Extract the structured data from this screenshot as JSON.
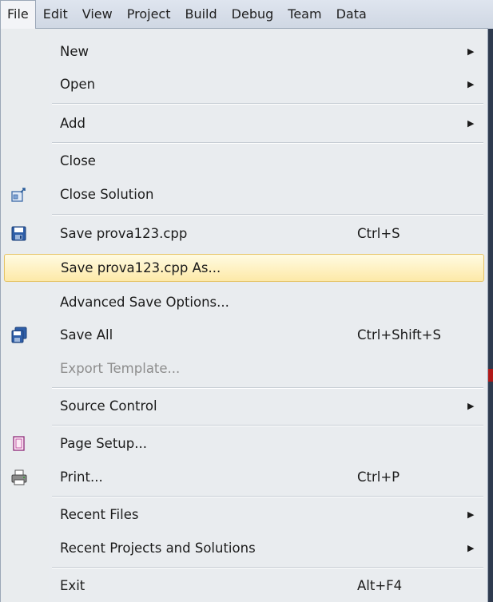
{
  "menubar": {
    "items": [
      {
        "label": "File",
        "active": true
      },
      {
        "label": "Edit"
      },
      {
        "label": "View"
      },
      {
        "label": "Project"
      },
      {
        "label": "Build"
      },
      {
        "label": "Debug"
      },
      {
        "label": "Team"
      },
      {
        "label": "Data"
      }
    ]
  },
  "file_menu": {
    "items": [
      {
        "label": "New",
        "submenu": true
      },
      {
        "label": "Open",
        "submenu": true
      },
      {
        "label": "Add",
        "submenu": true
      },
      {
        "label": "Close"
      },
      {
        "label": "Close Solution",
        "icon": "close-solution-icon"
      },
      {
        "label": "Save prova123.cpp",
        "shortcut": "Ctrl+S",
        "icon": "save-icon"
      },
      {
        "label": "Save prova123.cpp As...",
        "highlighted": true
      },
      {
        "label": "Advanced Save Options..."
      },
      {
        "label": "Save All",
        "shortcut": "Ctrl+Shift+S",
        "icon": "save-all-icon"
      },
      {
        "label": "Export Template...",
        "disabled": true
      },
      {
        "label": "Source Control",
        "submenu": true
      },
      {
        "label": "Page Setup...",
        "icon": "page-setup-icon"
      },
      {
        "label": "Print...",
        "shortcut": "Ctrl+P",
        "icon": "printer-icon"
      },
      {
        "label": "Recent Files",
        "submenu": true
      },
      {
        "label": "Recent Projects and Solutions",
        "submenu": true
      },
      {
        "label": "Exit",
        "shortcut": "Alt+F4"
      }
    ],
    "submenu_arrow": "▶"
  },
  "colors": {
    "highlight_fill": "#fde9a8",
    "highlight_border": "#e5c365",
    "menu_background": "#e9ecef",
    "disabled_text": "#8d8d8d"
  }
}
